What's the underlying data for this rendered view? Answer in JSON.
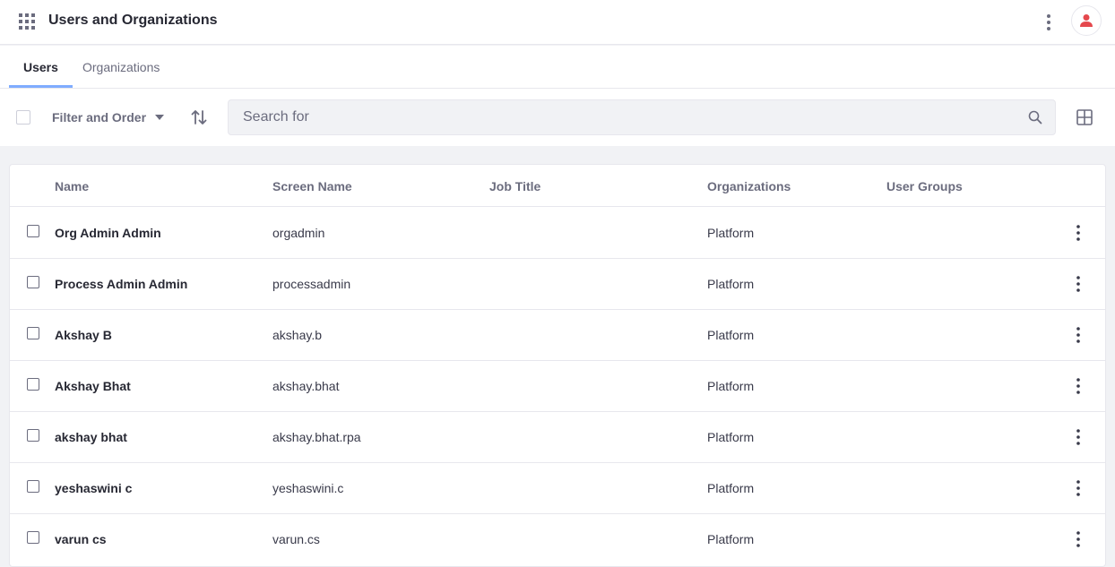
{
  "header": {
    "title": "Users and Organizations",
    "apps_icon": "apps-grid-icon",
    "options_icon": "kebab-vertical-icon",
    "avatar_icon": "user-icon",
    "accent": "#e5484d"
  },
  "tabs": [
    {
      "label": "Users",
      "active": true
    },
    {
      "label": "Organizations",
      "active": false
    }
  ],
  "toolbar": {
    "filter_label": "Filter and Order",
    "search_placeholder": "Search for",
    "search_value": ""
  },
  "table": {
    "columns": [
      "Name",
      "Screen Name",
      "Job Title",
      "Organizations",
      "User Groups"
    ],
    "rows": [
      {
        "name": "Org Admin Admin",
        "screen_name": "orgadmin",
        "job_title": "",
        "organizations": "Platform",
        "user_groups": ""
      },
      {
        "name": "Process Admin Admin",
        "screen_name": "processadmin",
        "job_title": "",
        "organizations": "Platform",
        "user_groups": ""
      },
      {
        "name": "Akshay B",
        "screen_name": "akshay.b",
        "job_title": "",
        "organizations": "Platform",
        "user_groups": ""
      },
      {
        "name": "Akshay Bhat",
        "screen_name": "akshay.bhat",
        "job_title": "",
        "organizations": "Platform",
        "user_groups": ""
      },
      {
        "name": "akshay bhat",
        "screen_name": "akshay.bhat.rpa",
        "job_title": "",
        "organizations": "Platform",
        "user_groups": ""
      },
      {
        "name": "yeshaswini c",
        "screen_name": "yeshaswini.c",
        "job_title": "",
        "organizations": "Platform",
        "user_groups": ""
      },
      {
        "name": "varun cs",
        "screen_name": "varun.cs",
        "job_title": "",
        "organizations": "Platform",
        "user_groups": ""
      }
    ]
  }
}
